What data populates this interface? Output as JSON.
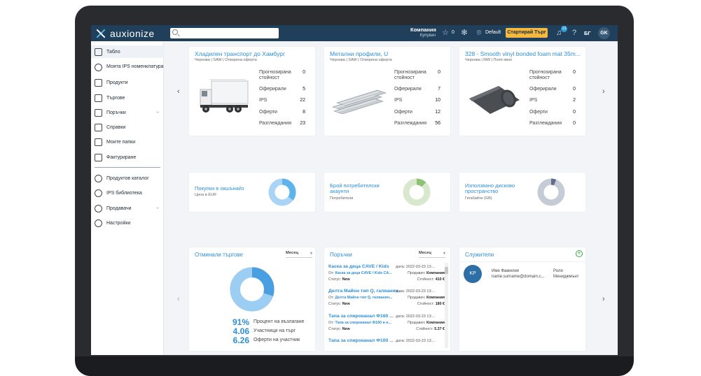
{
  "topbar": {
    "brand": "auxionize",
    "search_placeholder": "",
    "company_name": "Компания",
    "company_role": "Купувач",
    "star_count": "0",
    "default_label": "Default",
    "start_auction_label": "Стартирай Търг",
    "notification_count": "13",
    "language": "БГ",
    "user_initials": "GK"
  },
  "sidebar": {
    "items": [
      {
        "label": "Табло"
      },
      {
        "label": "Моята IPS номенклатура"
      },
      {
        "label": "Продукти"
      },
      {
        "label": "Търгове"
      },
      {
        "label": "Поръчки"
      },
      {
        "label": "Справки"
      },
      {
        "label": "Моите папки"
      },
      {
        "label": "Фактуриране"
      },
      {
        "label": "Продуктов каталог"
      },
      {
        "label": "IPS библиотека"
      },
      {
        "label": "Продавачи"
      },
      {
        "label": "Настройки"
      }
    ],
    "collapse_glyph": "«"
  },
  "auctions": [
    {
      "title": "Хладилен транспорт до Хамбург",
      "subtitle": "Чернова | SAW | Отворена оферта",
      "image": "refrigerated-truck",
      "stats": [
        {
          "label": "Прогнозирана стойност",
          "value": "0"
        },
        {
          "label": "Оферирали",
          "value": "5"
        },
        {
          "label": "IPS",
          "value": "22"
        },
        {
          "label": "Оферти",
          "value": "8"
        },
        {
          "label": "Разглеждания",
          "value": "23"
        }
      ]
    },
    {
      "title": "Метални профили, U",
      "subtitle": "Чернова | SAW | Отворена оферта",
      "image": "metal-profiles",
      "stats": [
        {
          "label": "Прогнозирана стойност",
          "value": "0"
        },
        {
          "label": "Оферирали",
          "value": "7"
        },
        {
          "label": "IPS",
          "value": "10"
        },
        {
          "label": "Оферти",
          "value": "12"
        },
        {
          "label": "Разглеждания",
          "value": "56"
        }
      ]
    },
    {
      "title": "328 - Smooth vinyl bonded foam mat 35m...",
      "subtitle": "Чернова | MW | Поля явно",
      "image": "foam-mat-roll",
      "stats": [
        {
          "label": "Прогнозирана стойност",
          "value": "0"
        },
        {
          "label": "Оферирали",
          "value": "0"
        },
        {
          "label": "IPS",
          "value": "2"
        },
        {
          "label": "Оферти",
          "value": "0"
        },
        {
          "label": "Разглеждания",
          "value": "0"
        }
      ]
    }
  ],
  "widgets": [
    {
      "title": "Покупки в окшънайз",
      "subtitle": "Цена в EUR",
      "colors": [
        "#5fb3ec",
        "#a9d4f5"
      ],
      "split": 0.35
    },
    {
      "title": "Брой потребителски акаунти",
      "subtitle": "Потребители",
      "colors": [
        "#8cc474",
        "#d7e8cc"
      ],
      "split": 0.12
    },
    {
      "title": "Използвано дисково пространство",
      "subtitle": "Гигабайти (GB)",
      "colors": [
        "#5c6e88",
        "#c5ccd6"
      ],
      "split": 0.06
    }
  ],
  "past_auctions": {
    "title": "Отминали търгове",
    "period": "Месец",
    "colors": [
      "#4a9fe0",
      "#9ccdf3"
    ],
    "split": 0.3,
    "rows": [
      {
        "value": "91%",
        "text": "Процент на възлагане"
      },
      {
        "value": "4.06",
        "text": "Участници на търг"
      },
      {
        "value": "6.26",
        "text": "Оферти на участник"
      }
    ]
  },
  "orders": {
    "title": "Поръчки",
    "period": "Месец",
    "items": [
      {
        "title": "Каска за деца CAVE / Kids",
        "date": "дата: 2022-03-23 13:...",
        "from_label": "От:",
        "from": "Каска за деца CAVE / Kids CA...",
        "seller_label": "Продавач:",
        "seller": "Компания",
        "status_label": "Статус:",
        "status": "New",
        "value_label": "Стойност:",
        "value": "410 €"
      },
      {
        "title": "Делта Майон тип Q, галванич...",
        "date": "дата: 2022-03-23 13:...",
        "from_label": "От:",
        "from": "Делта Майон тип Q, галванич...",
        "seller_label": "Продавач:",
        "seller": "Компания",
        "status_label": "Статус:",
        "status": "New",
        "value_label": "Стойност:",
        "value": "180 €"
      },
      {
        "title": "Тапа за спироканал Ф160 ...",
        "date": "дата: 2022-03-23 13:...",
        "from_label": "От:",
        "from": "Тапа за спироканал Ф160 в н...",
        "seller_label": "Продавач:",
        "seller": "Компания",
        "status_label": "Статус:",
        "status": "New",
        "value_label": "Стойност:",
        "value": "5.37 €"
      },
      {
        "title": "Тапа за спироканал Ф100 ...",
        "date": "дата: 2022-03-23 13:..."
      }
    ]
  },
  "employees": {
    "title": "Служители",
    "items": [
      {
        "initials": "KP",
        "name": "Име Фамилия",
        "email": "name.surname@domain.c...",
        "role_label": "Роля",
        "role": "Мениджмънт"
      }
    ]
  }
}
